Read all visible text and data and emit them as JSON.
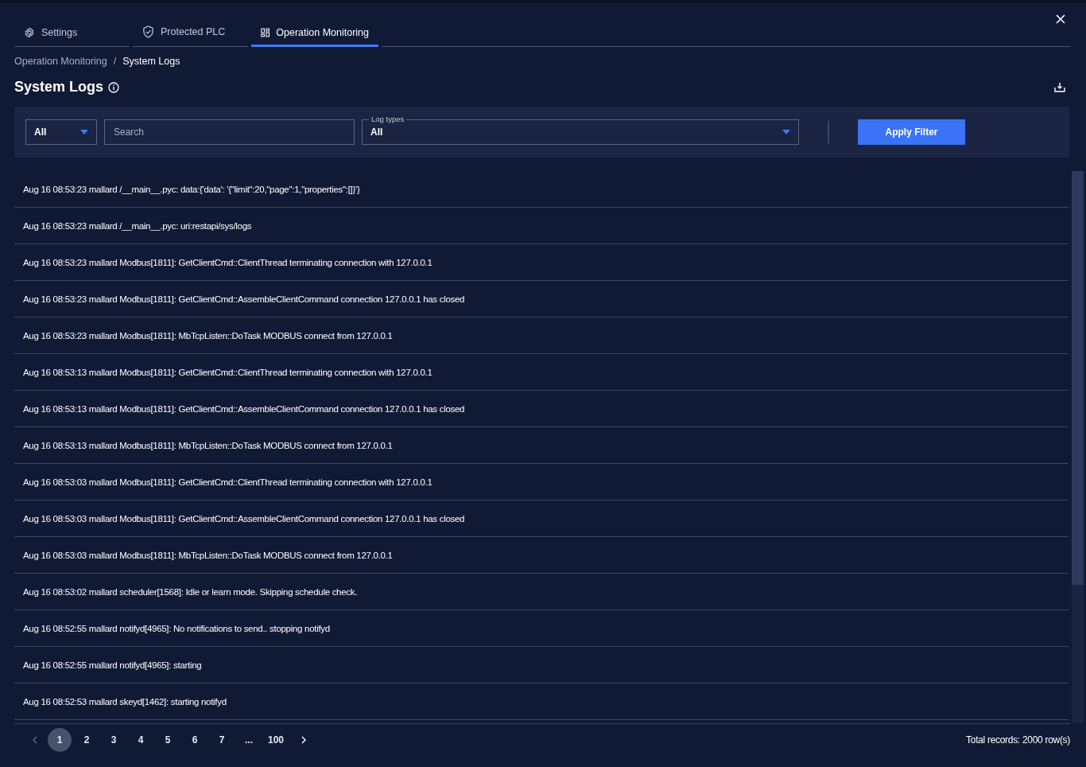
{
  "tabs": [
    {
      "label": "Settings",
      "kind": "gear",
      "selected": false
    },
    {
      "label": "Protected PLC",
      "kind": "shield",
      "selected": false
    },
    {
      "label": "Operation Monitoring",
      "kind": "grid",
      "selected": true
    }
  ],
  "breadcrumb": [
    "Operation Monitoring",
    "System Logs"
  ],
  "breadcrumb_separator": "/",
  "title": "System Logs",
  "filters": {
    "scope": "All",
    "search_placeholder": "Search",
    "log_types_label": "Log types",
    "log_types": "All",
    "apply": "Apply Filter"
  },
  "logs": [
    "Aug 16 08:53:23 mallard /__main__.pyc: data:{'data': '{\"limit\":20,\"page\":1,\"properties\":[]}'}",
    "Aug 16 08:53:23 mallard /__main__.pyc: uri:restapi/sys/logs",
    "Aug 16 08:53:23 mallard Modbus[1811]: GetClientCmd::ClientThread terminating connection with 127.0.0.1",
    "Aug 16 08:53:23 mallard Modbus[1811]: GetClientCmd::AssembleClientCommand connection 127.0.0.1 has closed",
    "Aug 16 08:53:23 mallard Modbus[1811]: MbTcpListen::DoTask MODBUS connect from 127.0.0.1",
    "Aug 16 08:53:13 mallard Modbus[1811]: GetClientCmd::ClientThread terminating connection with 127.0.0.1",
    "Aug 16 08:53:13 mallard Modbus[1811]: GetClientCmd::AssembleClientCommand connection 127.0.0.1 has closed",
    "Aug 16 08:53:13 mallard Modbus[1811]: MbTcpListen::DoTask MODBUS connect from 127.0.0.1",
    "Aug 16 08:53:03 mallard Modbus[1811]: GetClientCmd::ClientThread terminating connection with 127.0.0.1",
    "Aug 16 08:53:03 mallard Modbus[1811]: GetClientCmd::AssembleClientCommand connection 127.0.0.1 has closed",
    "Aug 16 08:53:03 mallard Modbus[1811]: MbTcpListen::DoTask MODBUS connect from 127.0.0.1",
    "Aug 16 08:53:02 mallard scheduler[1568]: Idle or learn mode. Skipping schedule check.",
    "Aug 16 08:52:55 mallard notifyd[4965]: No notifications to send.. stopping notifyd",
    "Aug 16 08:52:55 mallard notifyd[4965]: starting",
    "Aug 16 08:52:53 mallard skeyd[1462]: starting notifyd"
  ],
  "pagination": {
    "pages": [
      {
        "label": "1",
        "selected": true
      },
      {
        "label": "2",
        "selected": false
      },
      {
        "label": "3",
        "selected": false
      },
      {
        "label": "4",
        "selected": false
      },
      {
        "label": "5",
        "selected": false
      },
      {
        "label": "6",
        "selected": false
      },
      {
        "label": "7",
        "selected": false
      },
      {
        "label": "...",
        "selected": false
      },
      {
        "label": "100",
        "selected": false
      }
    ],
    "total": "Total records: 2000 row(s)"
  }
}
